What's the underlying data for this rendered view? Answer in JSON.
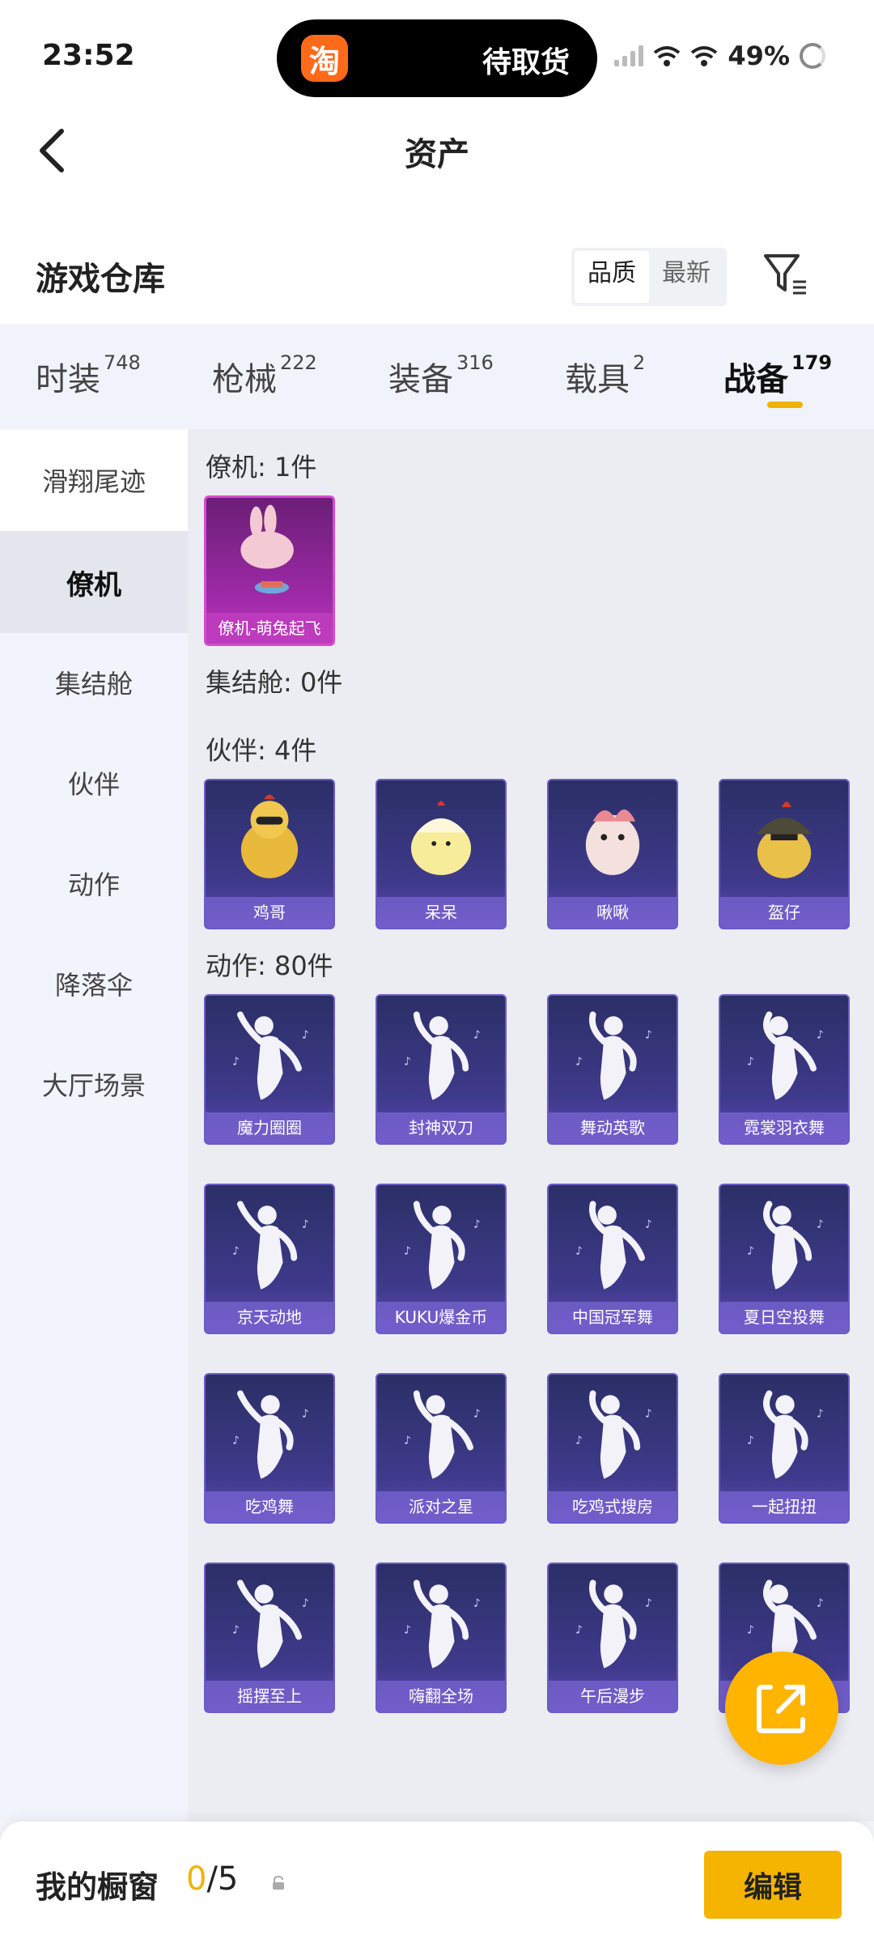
{
  "status_bar": {
    "time": "23:52",
    "app_badge": "淘",
    "notification": "待取货",
    "battery": "49%"
  },
  "nav": {
    "title": "资产"
  },
  "warehouse": {
    "title": "游戏仓库",
    "sort_options": [
      "品质",
      "最新"
    ],
    "active_sort": "品质"
  },
  "tabs": [
    {
      "label": "时装",
      "count": "748"
    },
    {
      "label": "枪械",
      "count": "222"
    },
    {
      "label": "装备",
      "count": "316"
    },
    {
      "label": "载具",
      "count": "2"
    },
    {
      "label": "战备",
      "count": "179"
    }
  ],
  "active_tab": "战备",
  "side_nav": [
    "滑翔尾迹",
    "僚机",
    "集结舱",
    "伙伴",
    "动作",
    "降落伞",
    "大厅场景"
  ],
  "active_side": "僚机",
  "sections": {
    "wingman": {
      "header": "僚机: 1件",
      "items": [
        "僚机-萌兔起飞"
      ]
    },
    "capsule": {
      "header": "集结舱: 0件"
    },
    "partner": {
      "header": "伙伴: 4件",
      "items": [
        "鸡哥",
        "呆呆",
        "啾啾",
        "盔仔"
      ]
    },
    "emote": {
      "header": "动作: 80件",
      "items": [
        "魔力圈圈",
        "封神双刀",
        "舞动英歌",
        "霓裳羽衣舞",
        "京天动地",
        "KUKU爆金币",
        "中国冠军舞",
        "夏日空投舞",
        "吃鸡舞",
        "派对之星",
        "吃鸡式搜房",
        "一起扭扭",
        "摇摆至上",
        "嗨翻全场",
        "午后漫步",
        ""
      ]
    }
  },
  "bottom": {
    "label": "我的橱窗",
    "current": "0",
    "total": "/5",
    "edit_label": "编辑"
  },
  "colors": {
    "accent": "#f5b400",
    "card_purple": "#3f3a8c",
    "card_pink": "#a02aa8"
  }
}
